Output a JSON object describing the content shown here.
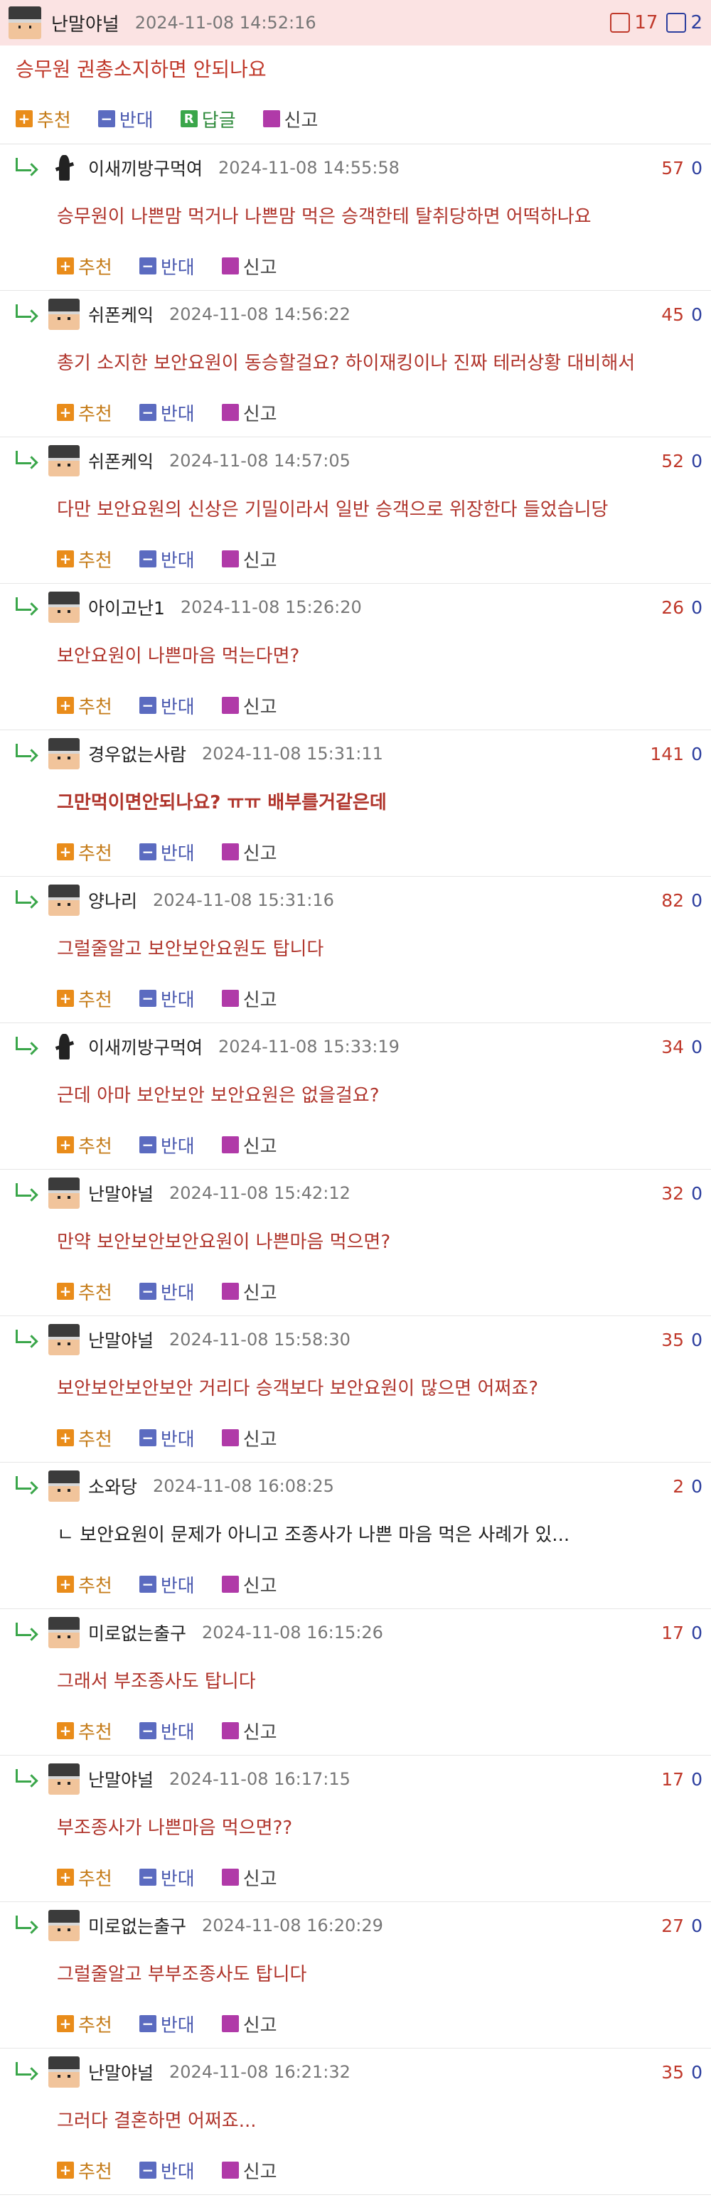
{
  "post": {
    "author": "난말야널",
    "date": "2024-11-08 14:52:16",
    "up": "17",
    "down": "2",
    "title": "승무원 권총소지하면 안되나요",
    "actions": {
      "recommend": "추천",
      "oppose": "반대",
      "reply": "답글",
      "report": "신고"
    }
  },
  "labels": {
    "recommend": "추천",
    "oppose": "반대",
    "report": "신고",
    "reply_icon": "R"
  },
  "colors": {
    "header_bg": "#fbe3e3",
    "accent_red": "#c0392b",
    "accent_blue": "#2c3e9e",
    "recommend": "#e98c1a"
  },
  "comments": [
    {
      "avatar": "ninja",
      "author": "이새끼방구먹여",
      "date": "2024-11-08 14:55:58",
      "up": "57",
      "down": "0",
      "text": "승무원이 나쁜맘 먹거나 나쁜맘 먹은 승객한테 탈취당하면 어떡하나요"
    },
    {
      "avatar": "face",
      "author": "쉬폰케익",
      "date": "2024-11-08 14:56:22",
      "up": "45",
      "down": "0",
      "text": "총기 소지한 보안요원이 동승할걸요? 하이재킹이나 진짜 테러상황 대비해서"
    },
    {
      "avatar": "face",
      "author": "쉬폰케익",
      "date": "2024-11-08 14:57:05",
      "up": "52",
      "down": "0",
      "text": "다만 보안요원의 신상은 기밀이라서 일반 승객으로 위장한다 들었습니당"
    },
    {
      "avatar": "face",
      "author": "아이고난1",
      "date": "2024-11-08 15:26:20",
      "up": "26",
      "down": "0",
      "text": "보안요원이 나쁜마음 먹는다면?"
    },
    {
      "avatar": "face",
      "author": "경우없는사람",
      "date": "2024-11-08 15:31:11",
      "up": "141",
      "down": "0",
      "text": "그만먹이면안되나요? ㅠㅠ 배부를거같은데"
    },
    {
      "avatar": "face",
      "author": "양나리",
      "date": "2024-11-08 15:31:16",
      "up": "82",
      "down": "0",
      "text": "그럴줄알고 보안보안요원도 탑니다"
    },
    {
      "avatar": "ninja",
      "author": "이새끼방구먹여",
      "date": "2024-11-08 15:33:19",
      "up": "34",
      "down": "0",
      "text": "근데 아마 보안보안 보안요원은 없을걸요?"
    },
    {
      "avatar": "face",
      "author": "난말야널",
      "date": "2024-11-08 15:42:12",
      "up": "32",
      "down": "0",
      "text": "만약 보안보안보안요원이 나쁜마음 먹으면?"
    },
    {
      "avatar": "face",
      "author": "난말야널",
      "date": "2024-11-08 15:58:30",
      "up": "35",
      "down": "0",
      "text": "보안보안보안보안 거리다 승객보다 보안요원이 많으면 어쩌죠?"
    },
    {
      "avatar": "face",
      "author": "소와당",
      "date": "2024-11-08 16:08:25",
      "up": "2",
      "down": "0",
      "text": "ㄴ 보안요원이 문제가 아니고 조종사가 나쁜 마음 먹은 사례가 있..."
    },
    {
      "avatar": "face",
      "author": "미로없는출구",
      "date": "2024-11-08 16:15:26",
      "up": "17",
      "down": "0",
      "text": "그래서 부조종사도 탑니다"
    },
    {
      "avatar": "face",
      "author": "난말야널",
      "date": "2024-11-08 16:17:15",
      "up": "17",
      "down": "0",
      "text": "부조종사가 나쁜마음 먹으면??"
    },
    {
      "avatar": "face",
      "author": "미로없는출구",
      "date": "2024-11-08 16:20:29",
      "up": "27",
      "down": "0",
      "text": "그럴줄알고 부부조종사도 탑니다"
    },
    {
      "avatar": "face",
      "author": "난말야널",
      "date": "2024-11-08 16:21:32",
      "up": "35",
      "down": "0",
      "text": "그러다 결혼하면 어쩌죠..."
    }
  ]
}
